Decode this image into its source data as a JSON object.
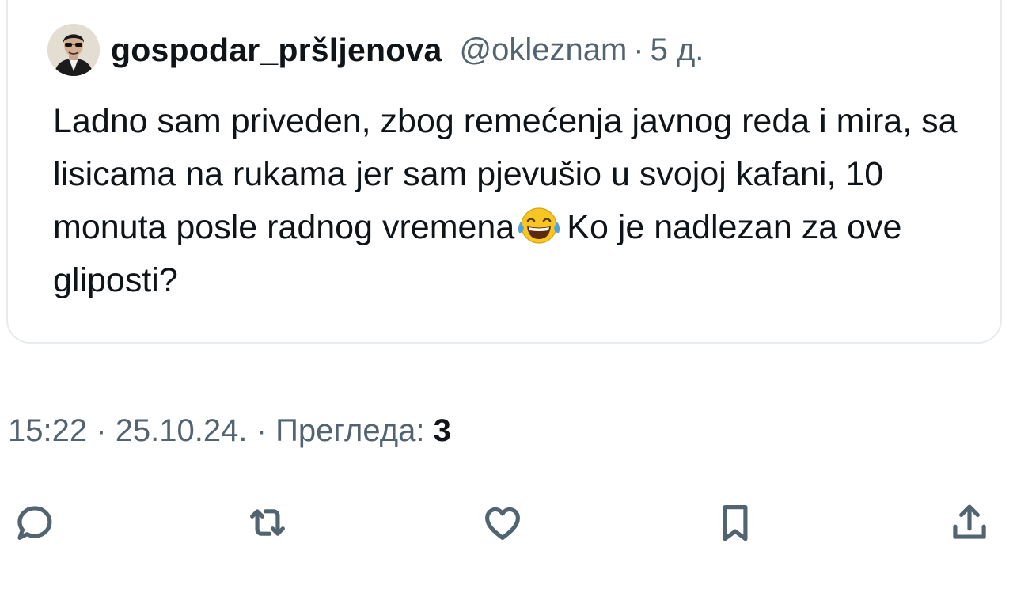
{
  "quoted_tweet": {
    "display_name": "gospodar_pršljenova",
    "handle": "@okleznam",
    "separator": "·",
    "age": "5 д.",
    "avatar_icon": "avatar-man-sunglasses",
    "text_before_emoji": "Ladno sam priveden, zbog remećenja javnog reda i mira, sa lisicama na rukama jer sam pjevušio u svojoj kafani, 10 monuta posle radnog vremena",
    "emoji": "face-with-tears-of-joy",
    "text_after_emoji": "Ko je nadlezan za ove gliposti?"
  },
  "meta": {
    "time": "15:22",
    "sep1": "·",
    "date": "25.10.24.",
    "sep2": "·",
    "views_label": "Прегледа:",
    "views_count": "3"
  },
  "actions": {
    "reply_icon": "reply-icon",
    "retweet_icon": "retweet-icon",
    "like_icon": "heart-icon",
    "bookmark_icon": "bookmark-icon",
    "share_icon": "share-icon"
  },
  "colors": {
    "text_primary": "#0f1419",
    "text_secondary": "#536471",
    "border": "#e8ebed"
  }
}
